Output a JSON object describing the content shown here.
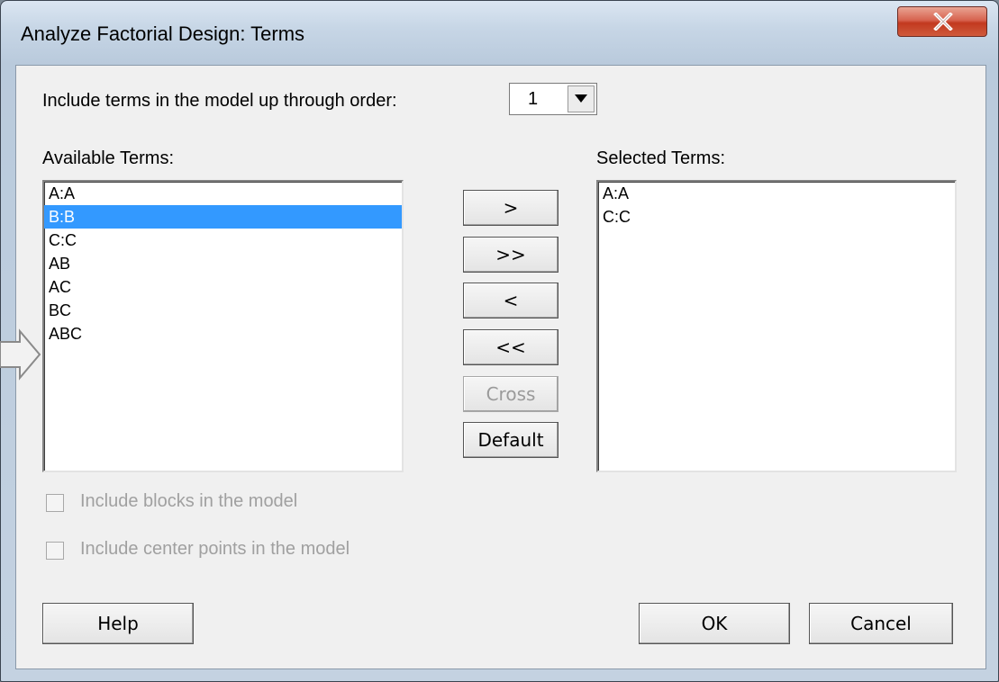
{
  "window": {
    "title": "Analyze Factorial Design: Terms"
  },
  "order": {
    "label": "Include terms in the model up through order:",
    "value": "1"
  },
  "available": {
    "label": "Available Terms:",
    "items": [
      "A:A",
      "B:B",
      "C:C",
      "AB",
      "AC",
      "BC",
      "ABC"
    ],
    "selected_index": 1
  },
  "selected": {
    "label": "Selected Terms:",
    "items": [
      "A:A",
      "C:C"
    ]
  },
  "move_buttons": {
    "add": ">",
    "add_all": ">>",
    "remove": "<",
    "remove_all": "<<",
    "cross": "Cross",
    "default": "Default"
  },
  "options": {
    "include_blocks": {
      "label": "Include blocks in the model",
      "checked": false,
      "enabled": false
    },
    "include_center_points": {
      "label": "Include center points in the model",
      "checked": false,
      "enabled": false
    }
  },
  "footer": {
    "help": "Help",
    "ok": "OK",
    "cancel": "Cancel"
  },
  "colors": {
    "selection": "#3399ff",
    "close_button": "#c2391f"
  }
}
